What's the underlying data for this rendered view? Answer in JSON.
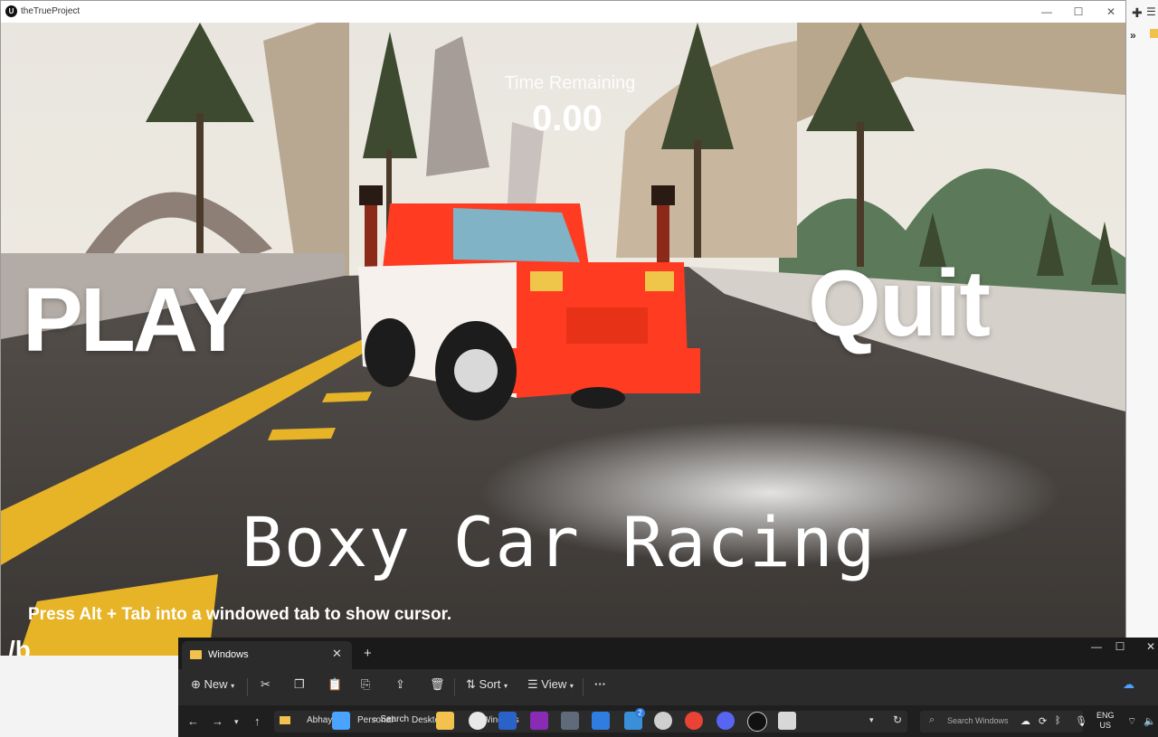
{
  "window": {
    "title": "theTrueProject",
    "logo_text": "U",
    "controls": {
      "minimize": "—",
      "maximize": "☐",
      "close": "✕"
    }
  },
  "hud": {
    "time_label": "Time Remaining",
    "time_value": "0.00"
  },
  "menu": {
    "play_label": "PLAY",
    "quit_label": "Quit",
    "game_title": "Boxy Car Racing",
    "hint": "Press Alt + Tab into a windowed tab to show cursor.",
    "corner_mark": "/b"
  },
  "explorer": {
    "tab_label": "Windows",
    "tab_close": "✕",
    "new_tab": "+",
    "controls": {
      "minimize": "—",
      "maximize": "☐",
      "close": "✕"
    },
    "toolbar": {
      "new_label": "New",
      "sort_label": "Sort",
      "view_label": "View",
      "more_label": "···"
    },
    "address": {
      "crumbs": [
        "Abhay",
        "Personal",
        "Desktop",
        "Windows"
      ],
      "search_placeholder": "Search Windows"
    }
  },
  "taskbar": {
    "search_label": "Search",
    "lang_top": "ENG",
    "lang_bottom": "US",
    "badge_count": "2"
  },
  "colors": {
    "car_red": "#ff3b22",
    "road_line": "#e7b427",
    "folder_yellow": "#f2c14e",
    "explorer_bg": "#1f1f1f"
  },
  "icons": [
    "ue-logo-icon",
    "folder-icon",
    "new-icon",
    "cut-icon",
    "copy-icon",
    "paste-icon",
    "rename-icon",
    "share-icon",
    "delete-icon",
    "sort-icon",
    "view-icon",
    "more-icon",
    "back-icon",
    "forward-icon",
    "up-icon",
    "refresh-icon",
    "search-icon",
    "onedrive-icon",
    "windows-start-icon",
    "file-explorer-icon",
    "chrome-icon",
    "word-icon",
    "onenote-icon",
    "calculator-icon",
    "todo-icon",
    "chatgpt-icon",
    "discord-icon",
    "unreal-icon",
    "wifi-icon",
    "volume-icon",
    "bluetooth-icon",
    "mic-icon",
    "cloud-icon"
  ]
}
